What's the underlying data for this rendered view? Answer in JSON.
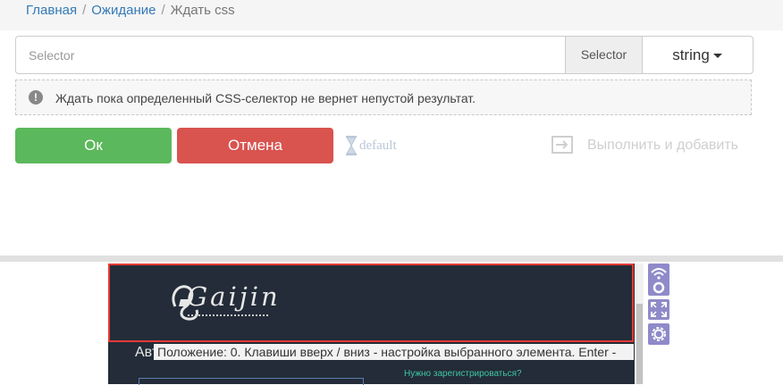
{
  "breadcrumb": {
    "home": "Главная",
    "parent": "Ожидание",
    "current": "Ждать css",
    "separator": "/"
  },
  "selector": {
    "placeholder": "Selector",
    "addon_label": "Selector",
    "type_value": "string"
  },
  "hint": {
    "icon": "info-circle-icon",
    "icon_glyph": "!",
    "text": "Ждать пока определенный CSS-селектор не вернет непустой результат."
  },
  "actions": {
    "ok_label": "Ок",
    "cancel_label": "Отмена",
    "default_label": "default",
    "run_add_label": "Выполнить и добавить"
  },
  "preview": {
    "logo_text": "Gaijin",
    "tooltip": "Положение: 0. Клавиши вверх / вниз - настройка выбранного элемента. Enter - ",
    "page_heading": "Авторизация",
    "page_link": "Нужно зарегистрироваться?",
    "tools": [
      "wifi-record-icon",
      "fullscreen-icon",
      "settings-gear-icon"
    ]
  },
  "colors": {
    "ok": "#5cb85c",
    "cancel": "#d9534f",
    "link": "#337ab7",
    "highlight": "#e53935",
    "tool": "#8f8ac9",
    "preview_bg": "#232c38"
  }
}
